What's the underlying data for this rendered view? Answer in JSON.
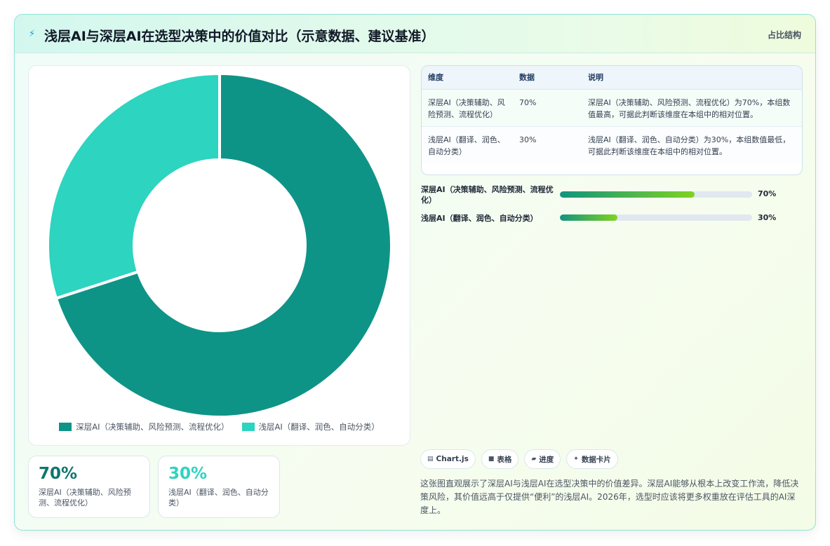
{
  "header": {
    "icon": "lightning-icon",
    "title": "浅层AI与深层AI在选型决策中的价值对比（示意数据、建议基准）",
    "right_label": "占比结构"
  },
  "chart_data": {
    "type": "pie",
    "categories": [
      "深层AI（决策辅助、风险预测、流程优化）",
      "浅层AI（翻译、润色、自动分类）"
    ],
    "values": [
      70,
      30
    ],
    "colors": [
      "#0e9486",
      "#2dd4bf"
    ],
    "legend": "bottom"
  },
  "stats": [
    {
      "value": "70%",
      "label": "深层AI（决策辅助、风险预测、流程优化）",
      "color": "#0f766e"
    },
    {
      "value": "30%",
      "label": "浅层AI（翻译、润色、自动分类）",
      "color": "#2dd4bf"
    }
  ],
  "table": {
    "headers": [
      "维度",
      "数据",
      "说明"
    ],
    "rows": [
      [
        "深层AI（决策辅助、风险预测、流程优化）",
        "70%",
        "深层AI（决策辅助、风险预测、流程优化）为70%，本组数值最高，可据此判断该维度在本组中的相对位置。"
      ],
      [
        "浅层AI（翻译、润色、自动分类）",
        "30%",
        "浅层AI（翻译、润色、自动分类）为30%，本组数值最低，可据此判断该维度在本组中的相对位置。"
      ]
    ]
  },
  "bars": [
    {
      "label": "深层AI（决策辅助、风险预测、流程优化）",
      "value": 70,
      "pct": "70%"
    },
    {
      "label": "浅层AI（翻译、润色、自动分类）",
      "value": 30,
      "pct": "30%"
    }
  ],
  "tags": [
    {
      "icon": "chart-icon",
      "glyph": "▤",
      "label": "Chart.js"
    },
    {
      "icon": "table-icon",
      "glyph": "■",
      "label": "表格"
    },
    {
      "icon": "progress-icon",
      "glyph": "▰",
      "label": "进度"
    },
    {
      "icon": "sparkle-icon",
      "glyph": "✦",
      "label": "数据卡片"
    }
  ],
  "note": "这张图直观展示了深层AI与浅层AI在选型决策中的价值差异。深层AI能够从根本上改变工作流，降低决策风险，其价值远高于仅提供“便利”的浅层AI。2026年，选型时应该将更多权重放在评估工具的AI深度上。"
}
